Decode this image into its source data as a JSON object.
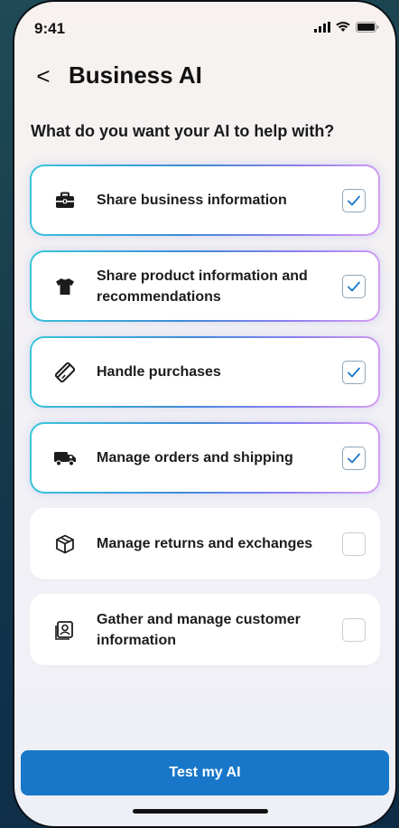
{
  "status_bar": {
    "time": "9:41"
  },
  "header": {
    "back_glyph": "<",
    "title": "Business AI"
  },
  "question": "What do you want your AI to help with?",
  "options": [
    {
      "label": "Share business information",
      "icon": "briefcase-icon",
      "checked": true
    },
    {
      "label": "Share product information and recommendations",
      "icon": "tshirt-icon",
      "checked": true
    },
    {
      "label": "Handle purchases",
      "icon": "credit-card-icon",
      "checked": true
    },
    {
      "label": "Manage orders and shipping",
      "icon": "truck-icon",
      "checked": true
    },
    {
      "label": "Manage returns and exchanges",
      "icon": "box-icon",
      "checked": false
    },
    {
      "label": "Gather and manage customer information",
      "icon": "contact-card-icon",
      "checked": false
    }
  ],
  "cta": {
    "label": "Test my AI"
  },
  "colors": {
    "primary": "#1877c9",
    "check": "#1877c9"
  }
}
